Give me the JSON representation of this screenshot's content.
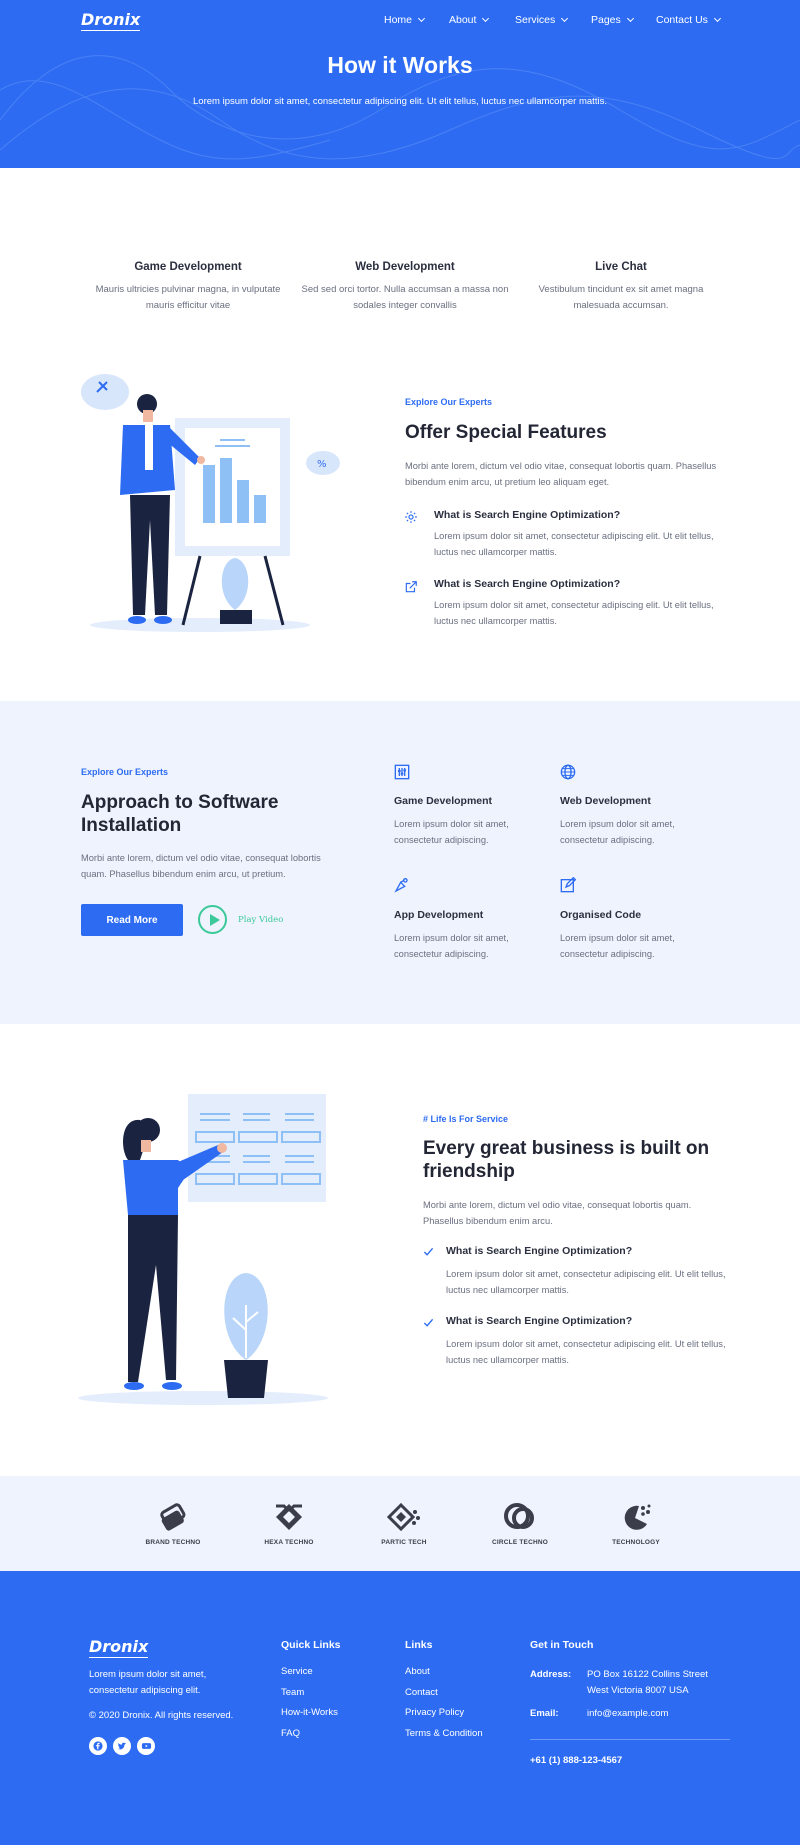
{
  "colors": {
    "primary": "#2d6cf2",
    "accent_green": "#3cc99a",
    "light_bg": "#eef3fd",
    "dark_text": "#232634"
  },
  "nav": {
    "logo": "Dronix",
    "items": [
      {
        "label": "Home"
      },
      {
        "label": "About"
      },
      {
        "label": "Services"
      },
      {
        "label": "Pages"
      },
      {
        "label": "Contact Us"
      }
    ]
  },
  "hero": {
    "title": "How it Works",
    "subtitle": "Lorem ipsum dolor sit amet, consectetur adipiscing elit. Ut elit tellus, luctus nec ullamcorper mattis."
  },
  "trio": [
    {
      "title": "Game Development",
      "text": "Mauris ultricies pulvinar magna, in vulputate mauris efficitur vitae"
    },
    {
      "title": "Web Development",
      "text": "Sed sed orci tortor. Nulla accumsan a massa non sodales integer convallis"
    },
    {
      "title": "Live Chat",
      "text": "Vestibulum tincidunt ex sit amet magna malesuada accumsan."
    }
  ],
  "offer": {
    "eyebrow": "Explore Our Experts",
    "title": "Offer Special Features",
    "text": "Morbi ante lorem, dictum vel odio vitae, consequat lobortis quam. Phasellus bibendum enim arcu, ut pretium leo aliquam eget.",
    "items": [
      {
        "icon": "gear-icon",
        "title": "What is Search Engine Optimization?",
        "text": "Lorem ipsum dolor sit amet, consectetur adipiscing elit. Ut elit tellus, luctus nec ullamcorper mattis."
      },
      {
        "icon": "external-link-icon",
        "title": "What is Search Engine Optimization?",
        "text": "Lorem ipsum dolor sit amet, consectetur adipiscing elit. Ut elit tellus, luctus nec ullamcorper mattis."
      }
    ]
  },
  "approach": {
    "eyebrow": "Explore Our Experts",
    "title": "Approach to Software Installation",
    "text": "Morbi ante lorem, dictum vel odio vitae, consequat lobortis quam. Phasellus bibendum enim arcu, ut pretium.",
    "read_more": "Read More",
    "play_label": "Play Video",
    "services": [
      {
        "icon": "sliders-icon",
        "title": "Game Development",
        "text": "Lorem ipsum dolor sit amet, consectetur adipiscing."
      },
      {
        "icon": "globe-icon",
        "title": "Web Development",
        "text": "Lorem ipsum dolor sit amet, consectetur adipiscing."
      },
      {
        "icon": "vector-pen-icon",
        "title": "App Development",
        "text": "Lorem ipsum dolor sit amet, consectetur adipiscing."
      },
      {
        "icon": "edit-icon",
        "title": "Organised Code",
        "text": "Lorem ipsum dolor sit amet, consectetur adipiscing."
      }
    ]
  },
  "friendship": {
    "eyebrow": "# Life Is For Service",
    "title": "Every great business is built on friendship",
    "text": "Morbi ante lorem, dictum vel odio vitae, consequat lobortis quam. Phasellus bibendum enim arcu.",
    "items": [
      {
        "title": "What is Search Engine Optimization?",
        "text": "Lorem ipsum dolor sit amet, consectetur adipiscing elit. Ut elit tellus, luctus nec ullamcorper mattis."
      },
      {
        "title": "What is Search Engine Optimization?",
        "text": "Lorem ipsum dolor sit amet, consectetur adipiscing elit. Ut elit tellus, luctus nec ullamcorper mattis."
      }
    ]
  },
  "brands": [
    {
      "label": "BRAND TECHNO"
    },
    {
      "label": "HEXA TECHNO"
    },
    {
      "label": "PARTIC TECH"
    },
    {
      "label": "CIRCLE TECHNO"
    },
    {
      "label": "TECHNOLOGY"
    }
  ],
  "footer": {
    "logo": "Dronix",
    "about": "Lorem ipsum dolor sit amet, consectetur adipiscing elit.",
    "copyright": "© 2020 Dronix. All rights reserved.",
    "quick_links": {
      "heading": "Quick Links",
      "items": [
        "Service",
        "Team",
        "How-it-Works",
        "FAQ"
      ]
    },
    "links": {
      "heading": "Links",
      "items": [
        "About",
        "Contact",
        "Privacy Policy",
        "Terms & Condition"
      ]
    },
    "contact": {
      "heading": "Get in Touch",
      "address_label": "Address:",
      "address_line1": "PO Box 16122 Collins Street",
      "address_line2": "West Victoria 8007 USA",
      "email_label": "Email:",
      "email": "info@example.com",
      "phone": "+61 (1) 888-123-4567"
    }
  }
}
